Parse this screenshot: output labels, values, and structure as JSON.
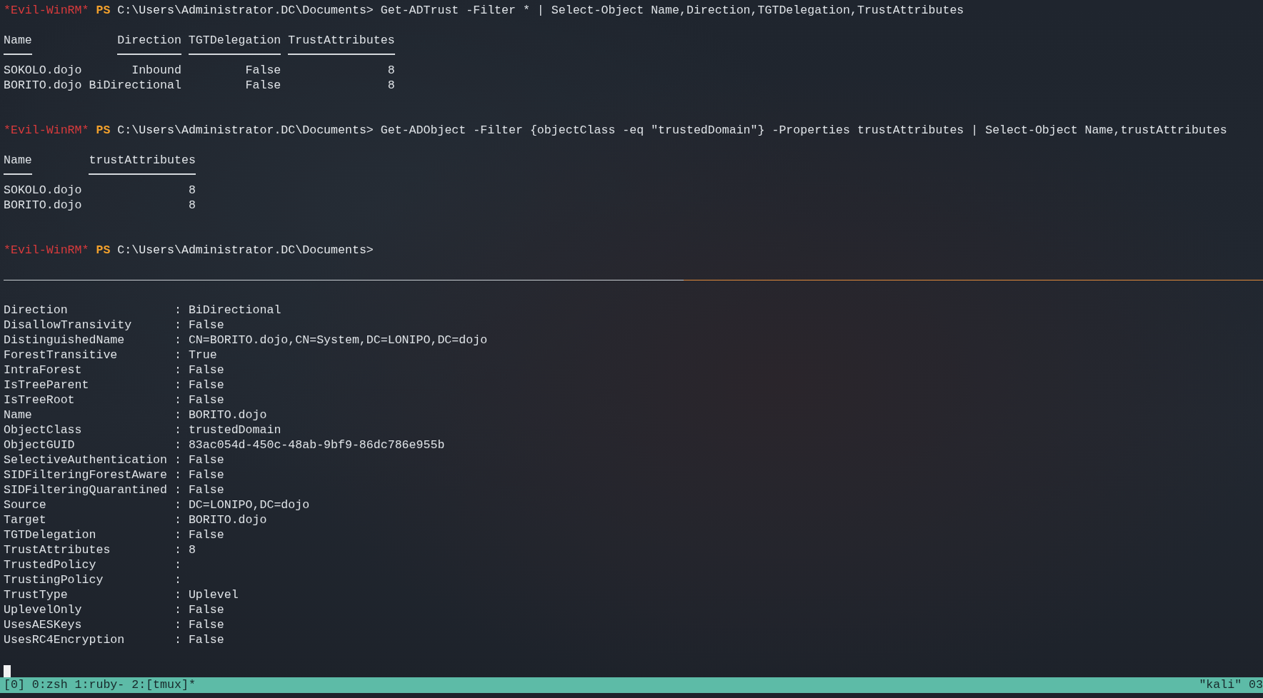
{
  "top_pane": {
    "active": false,
    "blocks": [
      {
        "kind": "prompt",
        "shell": "*Evil-WinRM*",
        "ps": "PS",
        "path": "C:\\Users\\Administrator.DC\\Documents>",
        "command": "Get-ADTrust -Filter * | Select-Object Name,Direction,TGTDelegation,TrustAttributes"
      },
      {
        "kind": "table",
        "columns": [
          "Name",
          "Direction",
          "TGTDelegation",
          "TrustAttributes"
        ],
        "rows": [
          [
            "SOKOLO.dojo",
            "Inbound",
            "False",
            "8"
          ],
          [
            "BORITO.dojo",
            "BiDirectional",
            "False",
            "8"
          ]
        ]
      },
      {
        "kind": "prompt",
        "shell": "*Evil-WinRM*",
        "ps": "PS",
        "path": "C:\\Users\\Administrator.DC\\Documents>",
        "command": "Get-ADObject -Filter {objectClass -eq \"trustedDomain\"} -Properties trustAttributes | Select-Object Name,trustAttributes"
      },
      {
        "kind": "table",
        "columns": [
          "Name",
          "trustAttributes"
        ],
        "rows": [
          [
            "SOKOLO.dojo",
            "8"
          ],
          [
            "BORITO.dojo",
            "8"
          ]
        ]
      },
      {
        "kind": "prompt",
        "shell": "*Evil-WinRM*",
        "ps": "PS",
        "path": "C:\\Users\\Administrator.DC\\Documents>"
      }
    ]
  },
  "bottom_pane": {
    "active": true,
    "properties": [
      {
        "name": "Direction",
        "value": ": BiDirectional"
      },
      {
        "name": "DisallowTransivity",
        "value": ": False"
      },
      {
        "name": "DistinguishedName",
        "value": ": CN=BORITO.dojo,CN=System,DC=LONIPO,DC=dojo"
      },
      {
        "name": "ForestTransitive",
        "value": ": True"
      },
      {
        "name": "IntraForest",
        "value": ": False"
      },
      {
        "name": "IsTreeParent",
        "value": ": False"
      },
      {
        "name": "IsTreeRoot",
        "value": ": False"
      },
      {
        "name": "Name",
        "value": ": BORITO.dojo"
      },
      {
        "name": "ObjectClass",
        "value": ": trustedDomain"
      },
      {
        "name": "ObjectGUID",
        "value": ": 83ac054d-450c-48ab-9bf9-86dc786e955b"
      },
      {
        "name": "SelectiveAuthentication",
        "value": ": False"
      },
      {
        "name": "SIDFilteringForestAware",
        "value": ": False"
      },
      {
        "name": "SIDFilteringQuarantined",
        "value": ": False"
      },
      {
        "name": "Source",
        "value": ": DC=LONIPO,DC=dojo"
      },
      {
        "name": "Target",
        "value": ": BORITO.dojo"
      },
      {
        "name": "TGTDelegation",
        "value": ": False"
      },
      {
        "name": "TrustAttributes",
        "value": ": 8"
      },
      {
        "name": "TrustedPolicy",
        "value": ":"
      },
      {
        "name": "TrustingPolicy",
        "value": ":"
      },
      {
        "name": "TrustType",
        "value": ": Uplevel"
      },
      {
        "name": "UplevelOnly",
        "value": ": False"
      },
      {
        "name": "UsesAESKeys",
        "value": ": False"
      },
      {
        "name": "UsesRC4Encryption",
        "value": ": False"
      }
    ],
    "cursor": true
  },
  "status_bar": {
    "session": "[0]",
    "windows": [
      "0:zsh",
      "1:ruby-",
      "2:[tmux]*"
    ],
    "host": "\"kali\" 03"
  }
}
